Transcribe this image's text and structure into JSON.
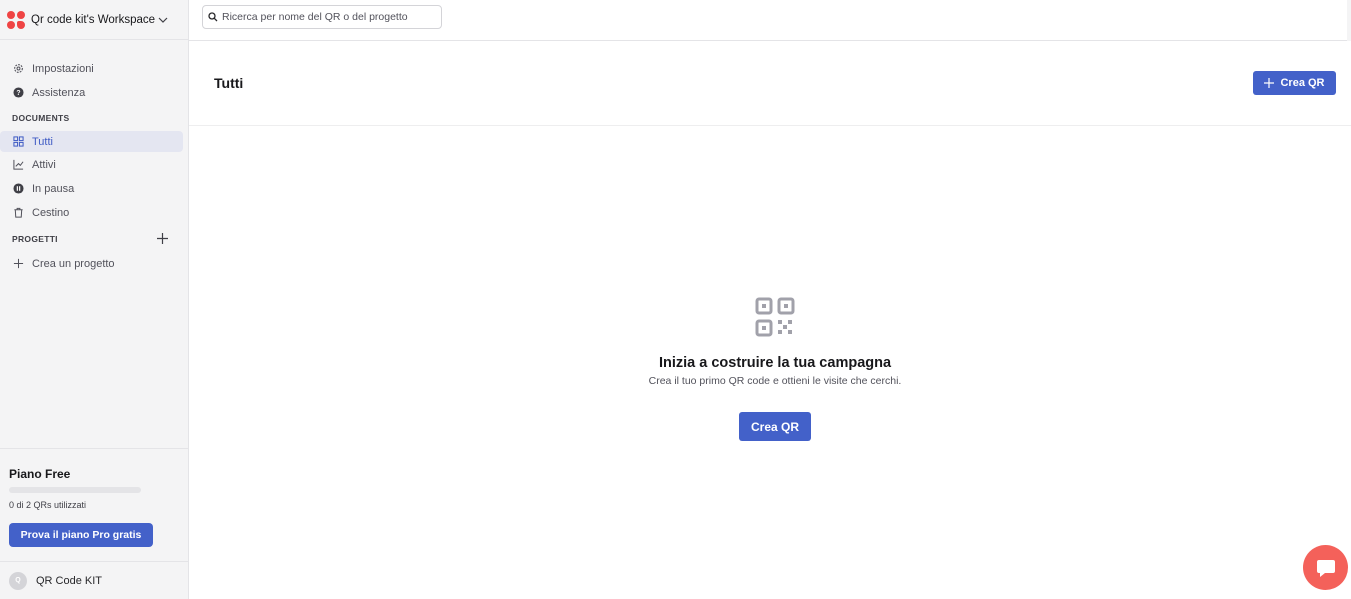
{
  "workspace": {
    "name": "Qr code kit's Workspace",
    "logo_color": "#ef4444"
  },
  "search": {
    "placeholder": "Ricerca per nome del QR o del progetto",
    "value": ""
  },
  "sidebar": {
    "top_items": [
      {
        "label": "Impostazioni",
        "icon": "gear-icon"
      },
      {
        "label": "Assistenza",
        "icon": "help-icon"
      }
    ],
    "documents_label": "DOCUMENTS",
    "document_items": [
      {
        "label": "Tutti",
        "icon": "grid-icon",
        "active": true
      },
      {
        "label": "Attivi",
        "icon": "chart-line-icon"
      },
      {
        "label": "In pausa",
        "icon": "pause-icon"
      },
      {
        "label": "Cestino",
        "icon": "trash-icon"
      }
    ],
    "projects_label": "PROGETTI",
    "create_project_label": "Crea un progetto"
  },
  "plan": {
    "title": "Piano Free",
    "usage_text": "0 di 2 QRs utilizzati",
    "usage_fraction": 0,
    "cta_label": "Prova il piano Pro gratis"
  },
  "user": {
    "initial": "Q",
    "name": "QR Code KIT"
  },
  "page": {
    "title": "Tutti",
    "create_button_label": "Crea QR"
  },
  "empty_state": {
    "icon": "qr-code-icon",
    "title": "Inizia a costruire la tua campagna",
    "subtitle": "Crea il tuo primo QR code e ottieni le visite che cerchi.",
    "button_label": "Crea QR"
  },
  "colors": {
    "accent": "#4361c9",
    "chat": "#f4615a"
  },
  "chat": {
    "icon": "chat-bubble-icon"
  }
}
